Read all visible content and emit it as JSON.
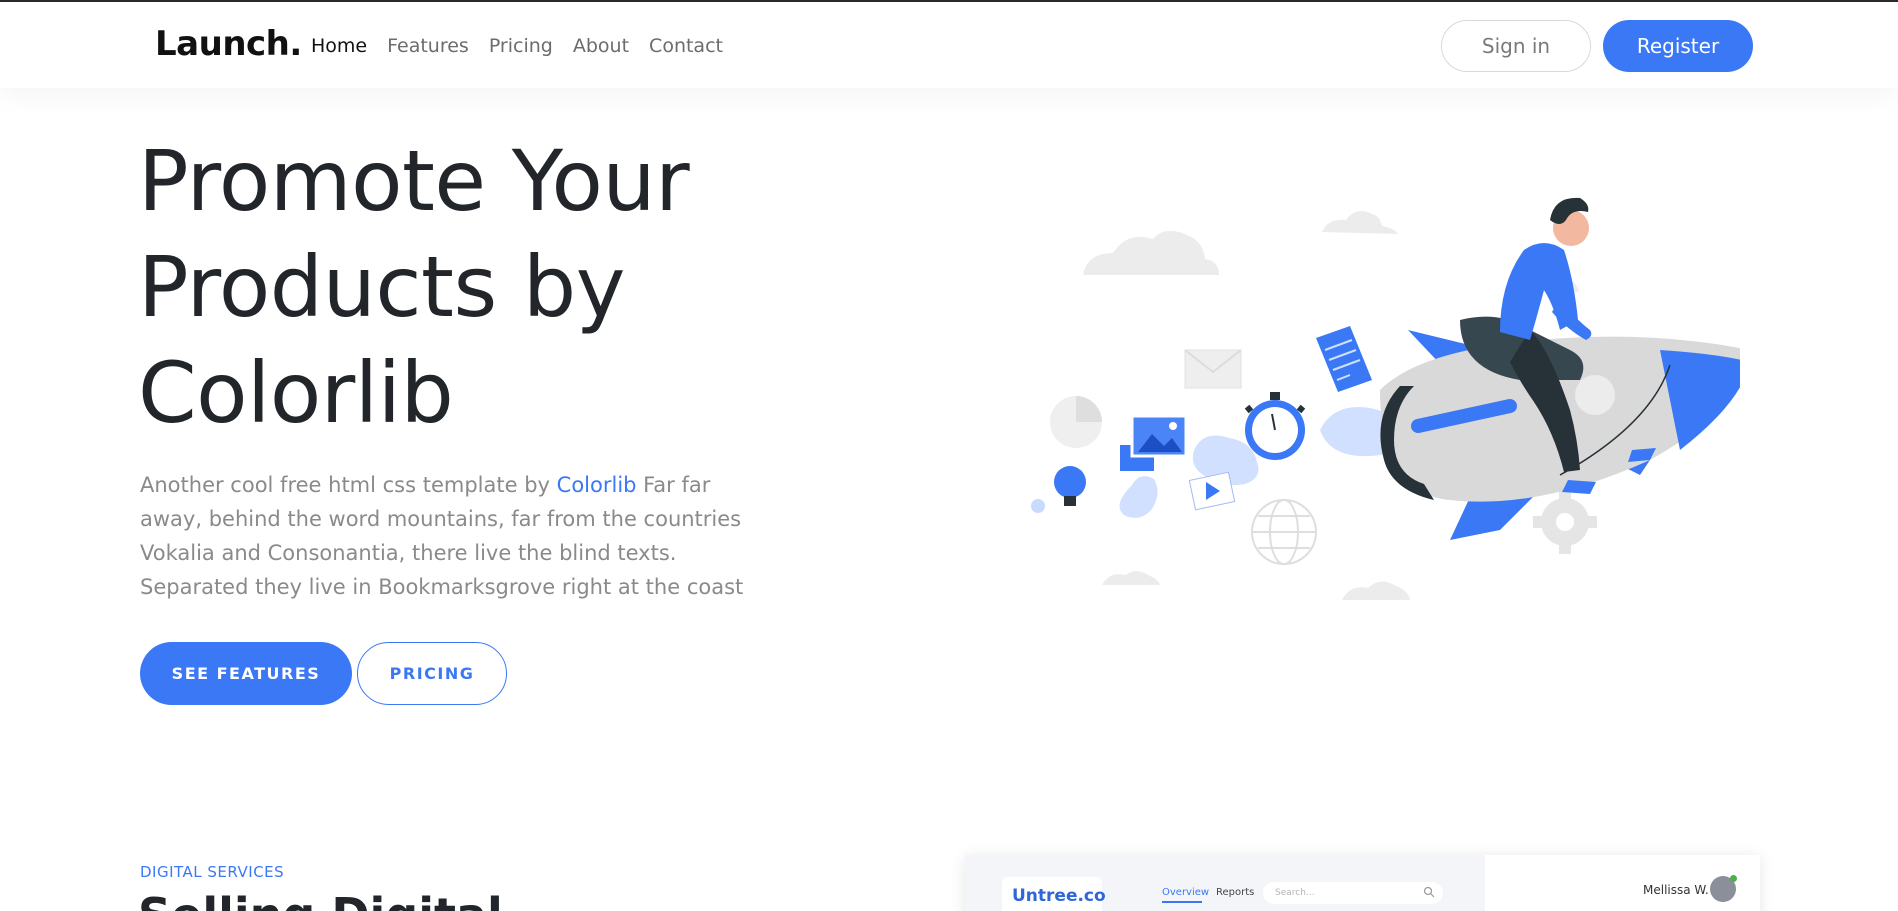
{
  "navbar": {
    "brand": "Launch.",
    "links": [
      "Home",
      "Features",
      "Pricing",
      "About",
      "Contact"
    ],
    "active_link": "Home",
    "signin_label": "Sign in",
    "register_label": "Register"
  },
  "hero": {
    "title_lines": [
      "Promote Your",
      "Products by",
      "Colorlib"
    ],
    "text_before_link": "Another cool free html css template by ",
    "link_text": "Colorlib",
    "text_after_link": " Far far away, behind the word mountains, far from the countries Vokalia and Consonantia, there live the blind texts. Separated they live in Bookmarksgrove right at the coast",
    "primary_button": "SEE FEATURES",
    "secondary_button": "PRICING",
    "illustration_icon": "rocket-man-illustration"
  },
  "section": {
    "label": "DIGITAL SERVICES",
    "title": "Selling Digital"
  },
  "dashboard_preview": {
    "logo": "Untree.co",
    "tabs": [
      "Overview",
      "Reports"
    ],
    "search_placeholder": "Search...",
    "user_name": "Mellissa W."
  },
  "colors": {
    "accent": "#3b78f5",
    "text_dark": "#22252a",
    "text_muted": "#8a8a8a"
  }
}
